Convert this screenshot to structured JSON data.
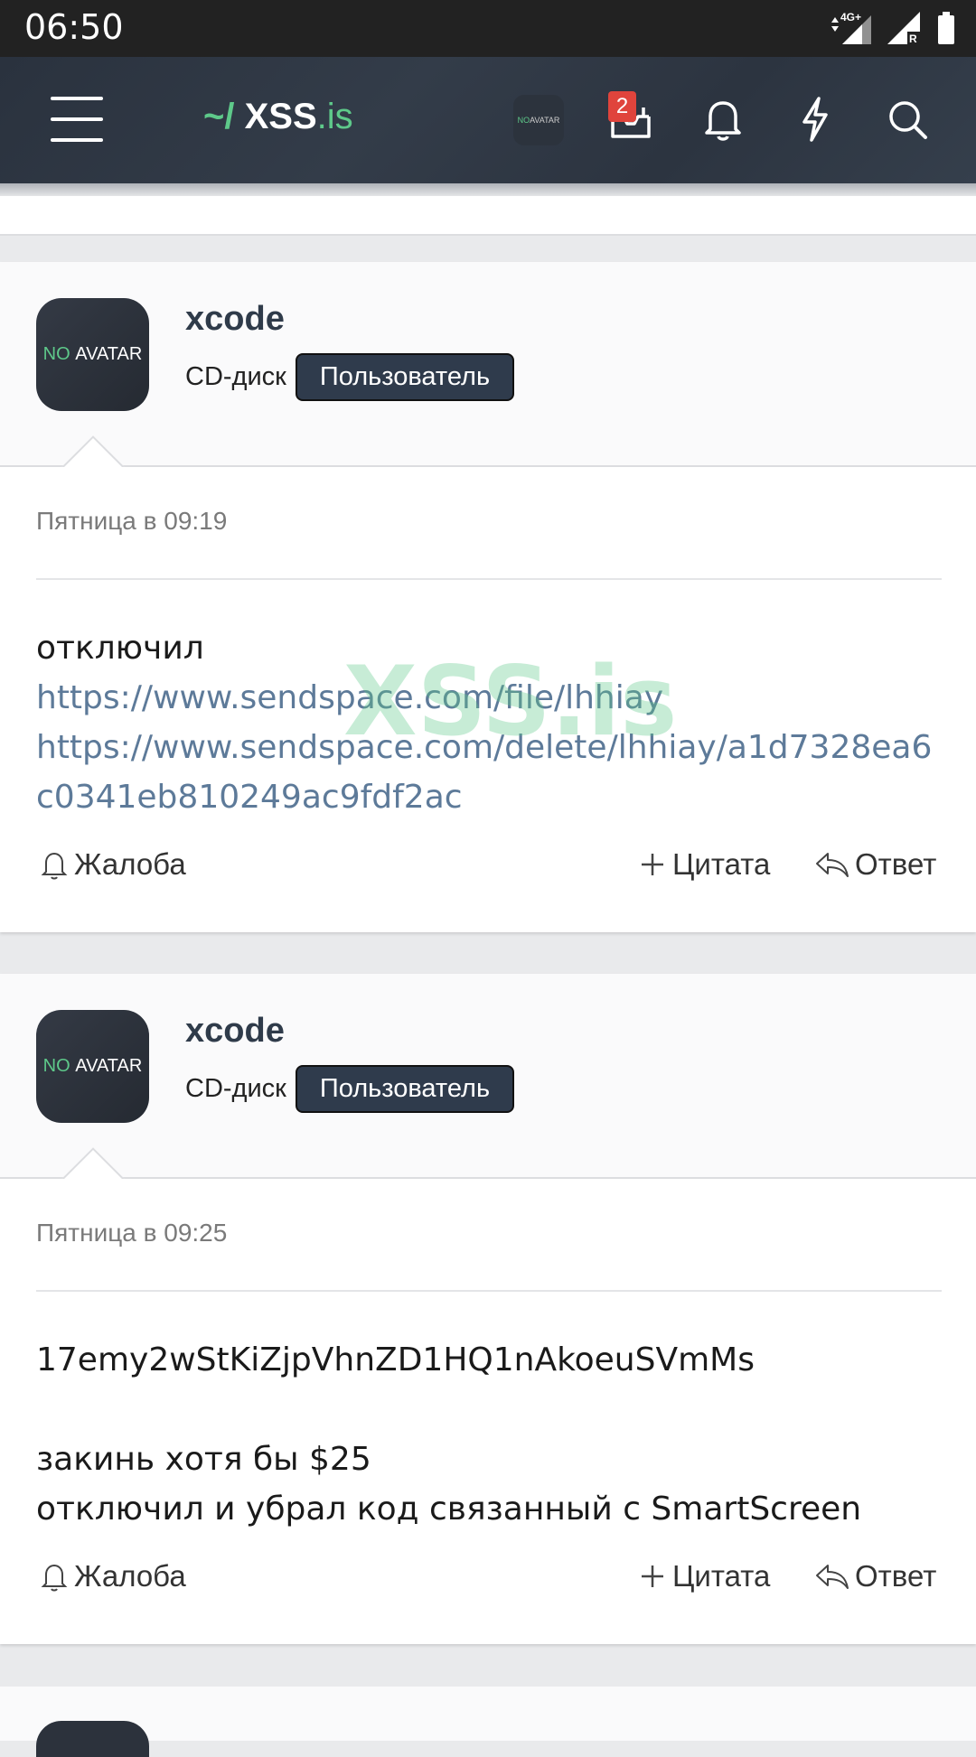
{
  "status_bar": {
    "time": "06:50",
    "network": "4G+",
    "roaming": "R"
  },
  "header": {
    "logo_prefix": "~/",
    "logo_name": "XSS",
    "logo_tld": ".is",
    "avatar_no": "NO",
    "avatar_text": "AVATAR",
    "inbox_badge": "2"
  },
  "watermark": "XSS.is",
  "posts": [
    {
      "avatar_no": "NO",
      "avatar_text": "AVATAR",
      "username": "xcode",
      "user_title": "CD-диск",
      "role": "Пользователь",
      "date": "Пятница в 09:19",
      "line1": "отключил",
      "link1": "https://www.sendspace.com/file/lhhiay",
      "link2": "https://www.sendspace.com/delete/lhhiay/a1d7328ea6c0341eb810249ac9fdf2ac",
      "report": "Жалоба",
      "quote": "Цитата",
      "reply": "Ответ"
    },
    {
      "avatar_no": "NO",
      "avatar_text": "AVATAR",
      "username": "xcode",
      "user_title": "CD-диск",
      "role": "Пользователь",
      "date": "Пятница в 09:25",
      "line1": "17emy2wStKiZjpVhnZD1HQ1nAkoeuSVmMs",
      "line2": "закинь хотя бы $25",
      "line3": "отключил и убрал код связанный с SmartScreen",
      "report": "Жалоба",
      "quote": "Цитата",
      "reply": "Ответ"
    }
  ],
  "colors": {
    "header_bg": "#2f3744",
    "accent": "#5ec98a",
    "badge": "#e0443c",
    "link": "#5d7a99",
    "role_bg": "#2f3b4c"
  }
}
